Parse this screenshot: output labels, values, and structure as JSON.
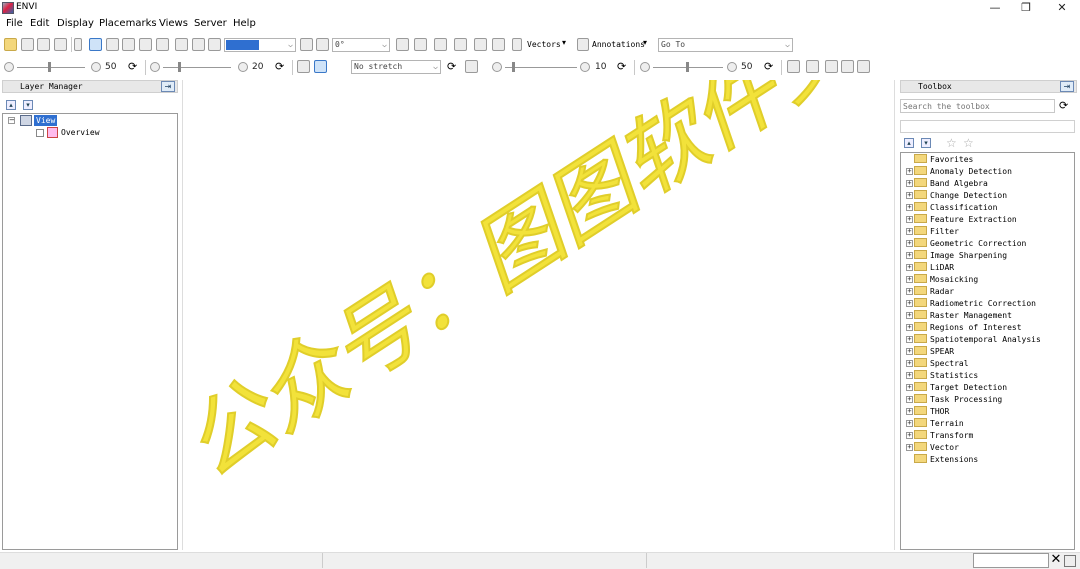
{
  "window": {
    "title": "ENVI",
    "controls": [
      "—",
      "❐",
      "✕"
    ]
  },
  "menu": [
    "File",
    "Edit",
    "Display",
    "Placemarks",
    "Views",
    "Server",
    "Help"
  ],
  "toolbar1": {
    "rotation_value": "0°",
    "vectors_label": "Vectors",
    "annotations_label": "Annotations",
    "goto_placeholder": "Go To",
    "accent_color": "#2f6fd0"
  },
  "toolbar2": {
    "brightness_value": "50",
    "contrast_value": "20",
    "stretch_value": "No stretch",
    "sharpen_value": "10",
    "transparency_value": "50"
  },
  "layer_manager": {
    "title": "Layer Manager",
    "view_node": "View",
    "overview_node": "Overview"
  },
  "toolbox": {
    "title": "Toolbox",
    "search_placeholder": "Search the toolbox",
    "items": [
      {
        "label": "Favorites",
        "expandable": false
      },
      {
        "label": "Anomaly Detection",
        "expandable": true
      },
      {
        "label": "Band Algebra",
        "expandable": true
      },
      {
        "label": "Change Detection",
        "expandable": true
      },
      {
        "label": "Classification",
        "expandable": true
      },
      {
        "label": "Feature Extraction",
        "expandable": true
      },
      {
        "label": "Filter",
        "expandable": true
      },
      {
        "label": "Geometric Correction",
        "expandable": true
      },
      {
        "label": "Image Sharpening",
        "expandable": true
      },
      {
        "label": "LiDAR",
        "expandable": true
      },
      {
        "label": "Mosaicking",
        "expandable": true
      },
      {
        "label": "Radar",
        "expandable": true
      },
      {
        "label": "Radiometric Correction",
        "expandable": true
      },
      {
        "label": "Raster Management",
        "expandable": true
      },
      {
        "label": "Regions of Interest",
        "expandable": true
      },
      {
        "label": "Spatiotemporal Analysis",
        "expandable": true
      },
      {
        "label": "SPEAR",
        "expandable": true
      },
      {
        "label": "Spectral",
        "expandable": true
      },
      {
        "label": "Statistics",
        "expandable": true
      },
      {
        "label": "Target Detection",
        "expandable": true
      },
      {
        "label": "Task Processing",
        "expandable": true
      },
      {
        "label": "THOR",
        "expandable": true
      },
      {
        "label": "Terrain",
        "expandable": true
      },
      {
        "label": "Transform",
        "expandable": true
      },
      {
        "label": "Vector",
        "expandable": true
      },
      {
        "label": "Extensions",
        "expandable": false
      }
    ]
  },
  "watermark": {
    "text": "公众号：图图软件安装",
    "color": "#f2e23a"
  }
}
